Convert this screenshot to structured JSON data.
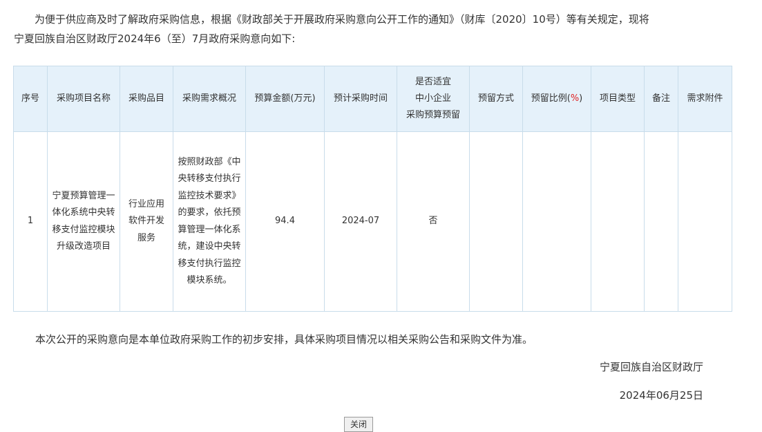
{
  "intro": {
    "line1": "为便于供应商及时了解政府采购信息，根据《财政部关于开展政府采购意向公开工作的通知》（财库〔2020〕10号）等有关规定，现将",
    "line2": "宁夏回族自治区财政厅2024年6（至）7月政府采购意向如下:"
  },
  "table": {
    "headers": {
      "seq": "序号",
      "project_name": "采购项目名称",
      "category": "采购品目",
      "demand": "采购需求概况",
      "budget": "预算金额(万元)",
      "time": "预计采购时间",
      "sme_line1": "是否适宜",
      "sme_line2": "中小企业",
      "sme_line3": "采购预算预留",
      "reserve_method": "预留方式",
      "reserve_ratio_prefix": "预留比例(",
      "reserve_ratio_pct": "%",
      "reserve_ratio_suffix": ")",
      "project_type": "项目类型",
      "remark": "备注",
      "attachment": "需求附件"
    },
    "rows": [
      {
        "seq": "1",
        "project_name": "宁夏预算管理一体化系统中央转移支付监控模块升级改造项目",
        "category": "行业应用软件开发服务",
        "demand": "按照财政部《中央转移支付执行监控技术要求》的要求，依托预算管理一体化系统，建设中央转移支付执行监控模块系统。",
        "budget": "94.4",
        "time": "2024-07",
        "sme": "否",
        "reserve_method": "",
        "reserve_ratio": "",
        "project_type": "",
        "remark": "",
        "attachment": ""
      }
    ]
  },
  "footnote": "本次公开的采购意向是本单位政府采购工作的初步安排，具体采购项目情况以相关采购公告和采购文件为准。",
  "signature": "宁夏回族自治区财政厅",
  "date": "2024年06月25日",
  "close_label": "关闭"
}
